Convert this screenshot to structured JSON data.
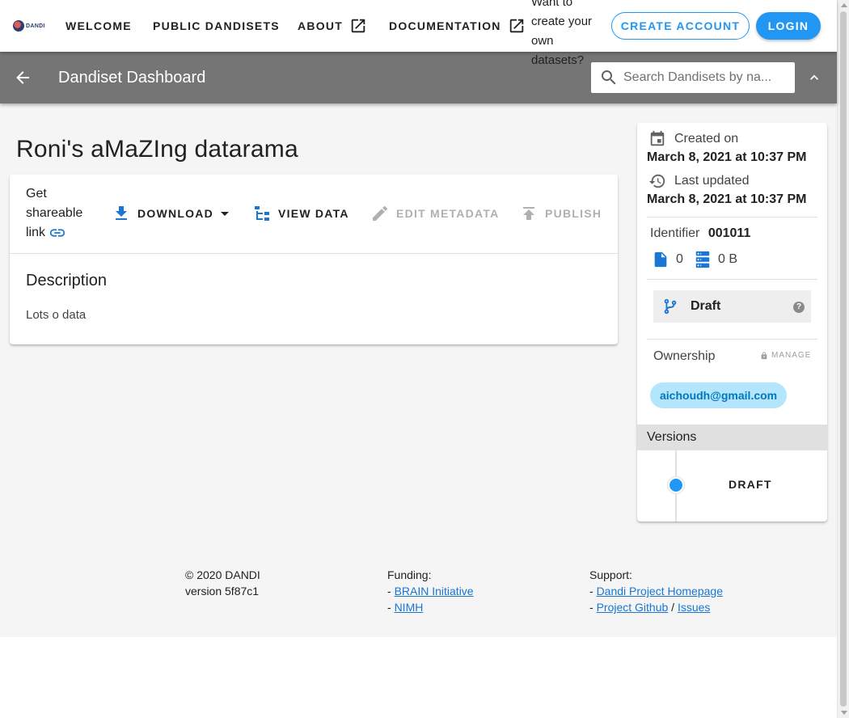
{
  "nav": {
    "logo_text": "DANDI",
    "links": [
      "WELCOME",
      "PUBLIC DANDISETS",
      "ABOUT",
      "DOCUMENTATION"
    ],
    "prompt": "Want to create your own datasets?",
    "create_account": "CREATE ACCOUNT",
    "login": "LOGIN"
  },
  "toolbar": {
    "title": "Dandiset Dashboard",
    "search_placeholder": "Search Dandisets by na..."
  },
  "dandiset": {
    "title": "Roni's aMaZIng datarama",
    "share_label": "Get shareable link",
    "actions": {
      "download": "DOWNLOAD",
      "view_data": "VIEW DATA",
      "edit_metadata": "EDIT METADATA",
      "publish": "PUBLISH"
    },
    "description_heading": "Description",
    "description_text": "Lots o data"
  },
  "meta": {
    "created_label": "Created on",
    "created_value": "March 8, 2021 at 10:37 PM",
    "updated_label": "Last updated",
    "updated_value": "March 8, 2021 at 10:37 PM",
    "identifier_label": "Identifier",
    "identifier_value": "001011",
    "file_count": "0",
    "size": "0 B",
    "status": "Draft",
    "ownership_label": "Ownership",
    "manage_label": "MANAGE",
    "owner_email": "aichoudh@gmail.com",
    "versions_label": "Versions",
    "version": "DRAFT"
  },
  "footer": {
    "copyright": "© 2020 DANDI",
    "version": "version 5f87c1",
    "funding_label": "Funding:",
    "funding_1": "BRAIN Initiative",
    "funding_2": "NIMH",
    "support_label": "Support:",
    "support_1": "Dandi Project Homepage",
    "support_2": "Project Github",
    "support_sep": "/",
    "support_3": "Issues",
    "bullet": "-"
  },
  "colors": {
    "primary": "#2196f3",
    "toolbar": "#757575",
    "chip_bg": "#b3e5fc"
  },
  "icons": [
    "back-arrow-icon",
    "search-icon",
    "chevron-up-icon",
    "open-in-new-icon",
    "link-icon",
    "download-icon",
    "caret-down-icon",
    "file-tree-icon",
    "pencil-icon",
    "upload-icon",
    "calendar-icon",
    "history-icon",
    "file-icon",
    "storage-icon",
    "source-branch-icon",
    "help-icon",
    "lock-icon"
  ]
}
